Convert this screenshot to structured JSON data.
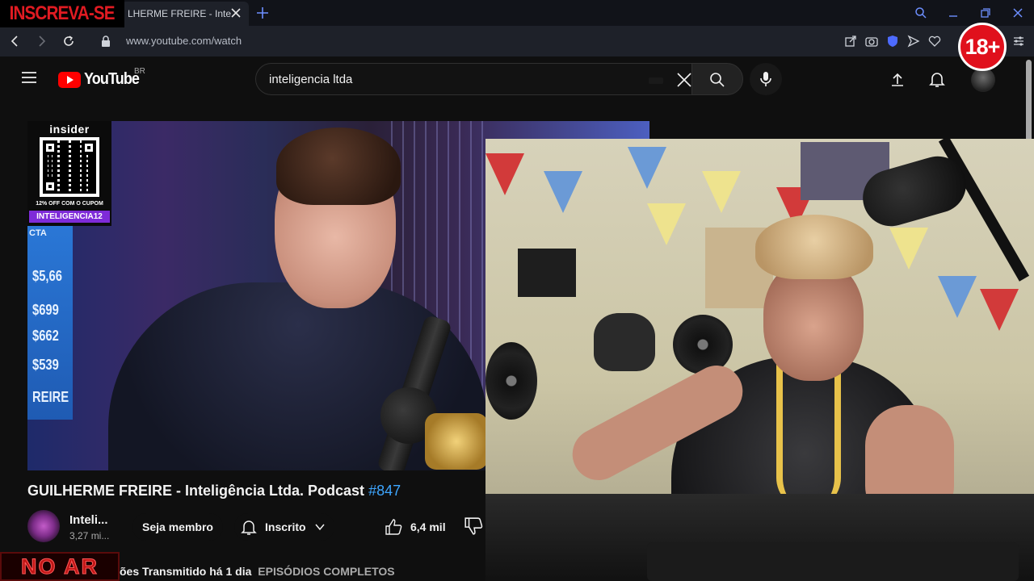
{
  "overlays": {
    "subscribe": "INSCREVA-SE",
    "age_rating": "18+",
    "live": "NO AR"
  },
  "browser": {
    "tab_title": "LHERME FREIRE - Inteligência Ltda",
    "url": "www.youtube.com/watch"
  },
  "youtube": {
    "logo_text": "YouTube",
    "country": "BR",
    "search_value": "inteligencia ltda"
  },
  "video": {
    "title": "GUILHERME FREIRE - Inteligência Ltda. Podcast ",
    "episode": "#847",
    "channel_name": "Inteli...",
    "channel_subs": "3,27 mi...",
    "join_label": "Seja membro",
    "subscribed_label": "Inscrito",
    "likes": "6,4 mil",
    "meta_prefix": "ões",
    "meta_streamed": "Transmitido há 1 dia",
    "meta_tag": "EPISÓDIOS COMPLETOS"
  },
  "insider_card": {
    "brand": "insider",
    "offer": "12% OFF COM O CUPOM",
    "coupon": "INTELIGENCIA12"
  },
  "scene_prices": [
    "$5,66",
    "$699",
    "$662",
    "$539"
  ],
  "scene_side_text": "REIRE",
  "scene_cta": "CTA",
  "colors": {
    "yt_red": "#ff0000",
    "link_blue": "#3ea6ff",
    "coupon_purple": "#7e2bd8",
    "badge_red": "#e0101c"
  }
}
